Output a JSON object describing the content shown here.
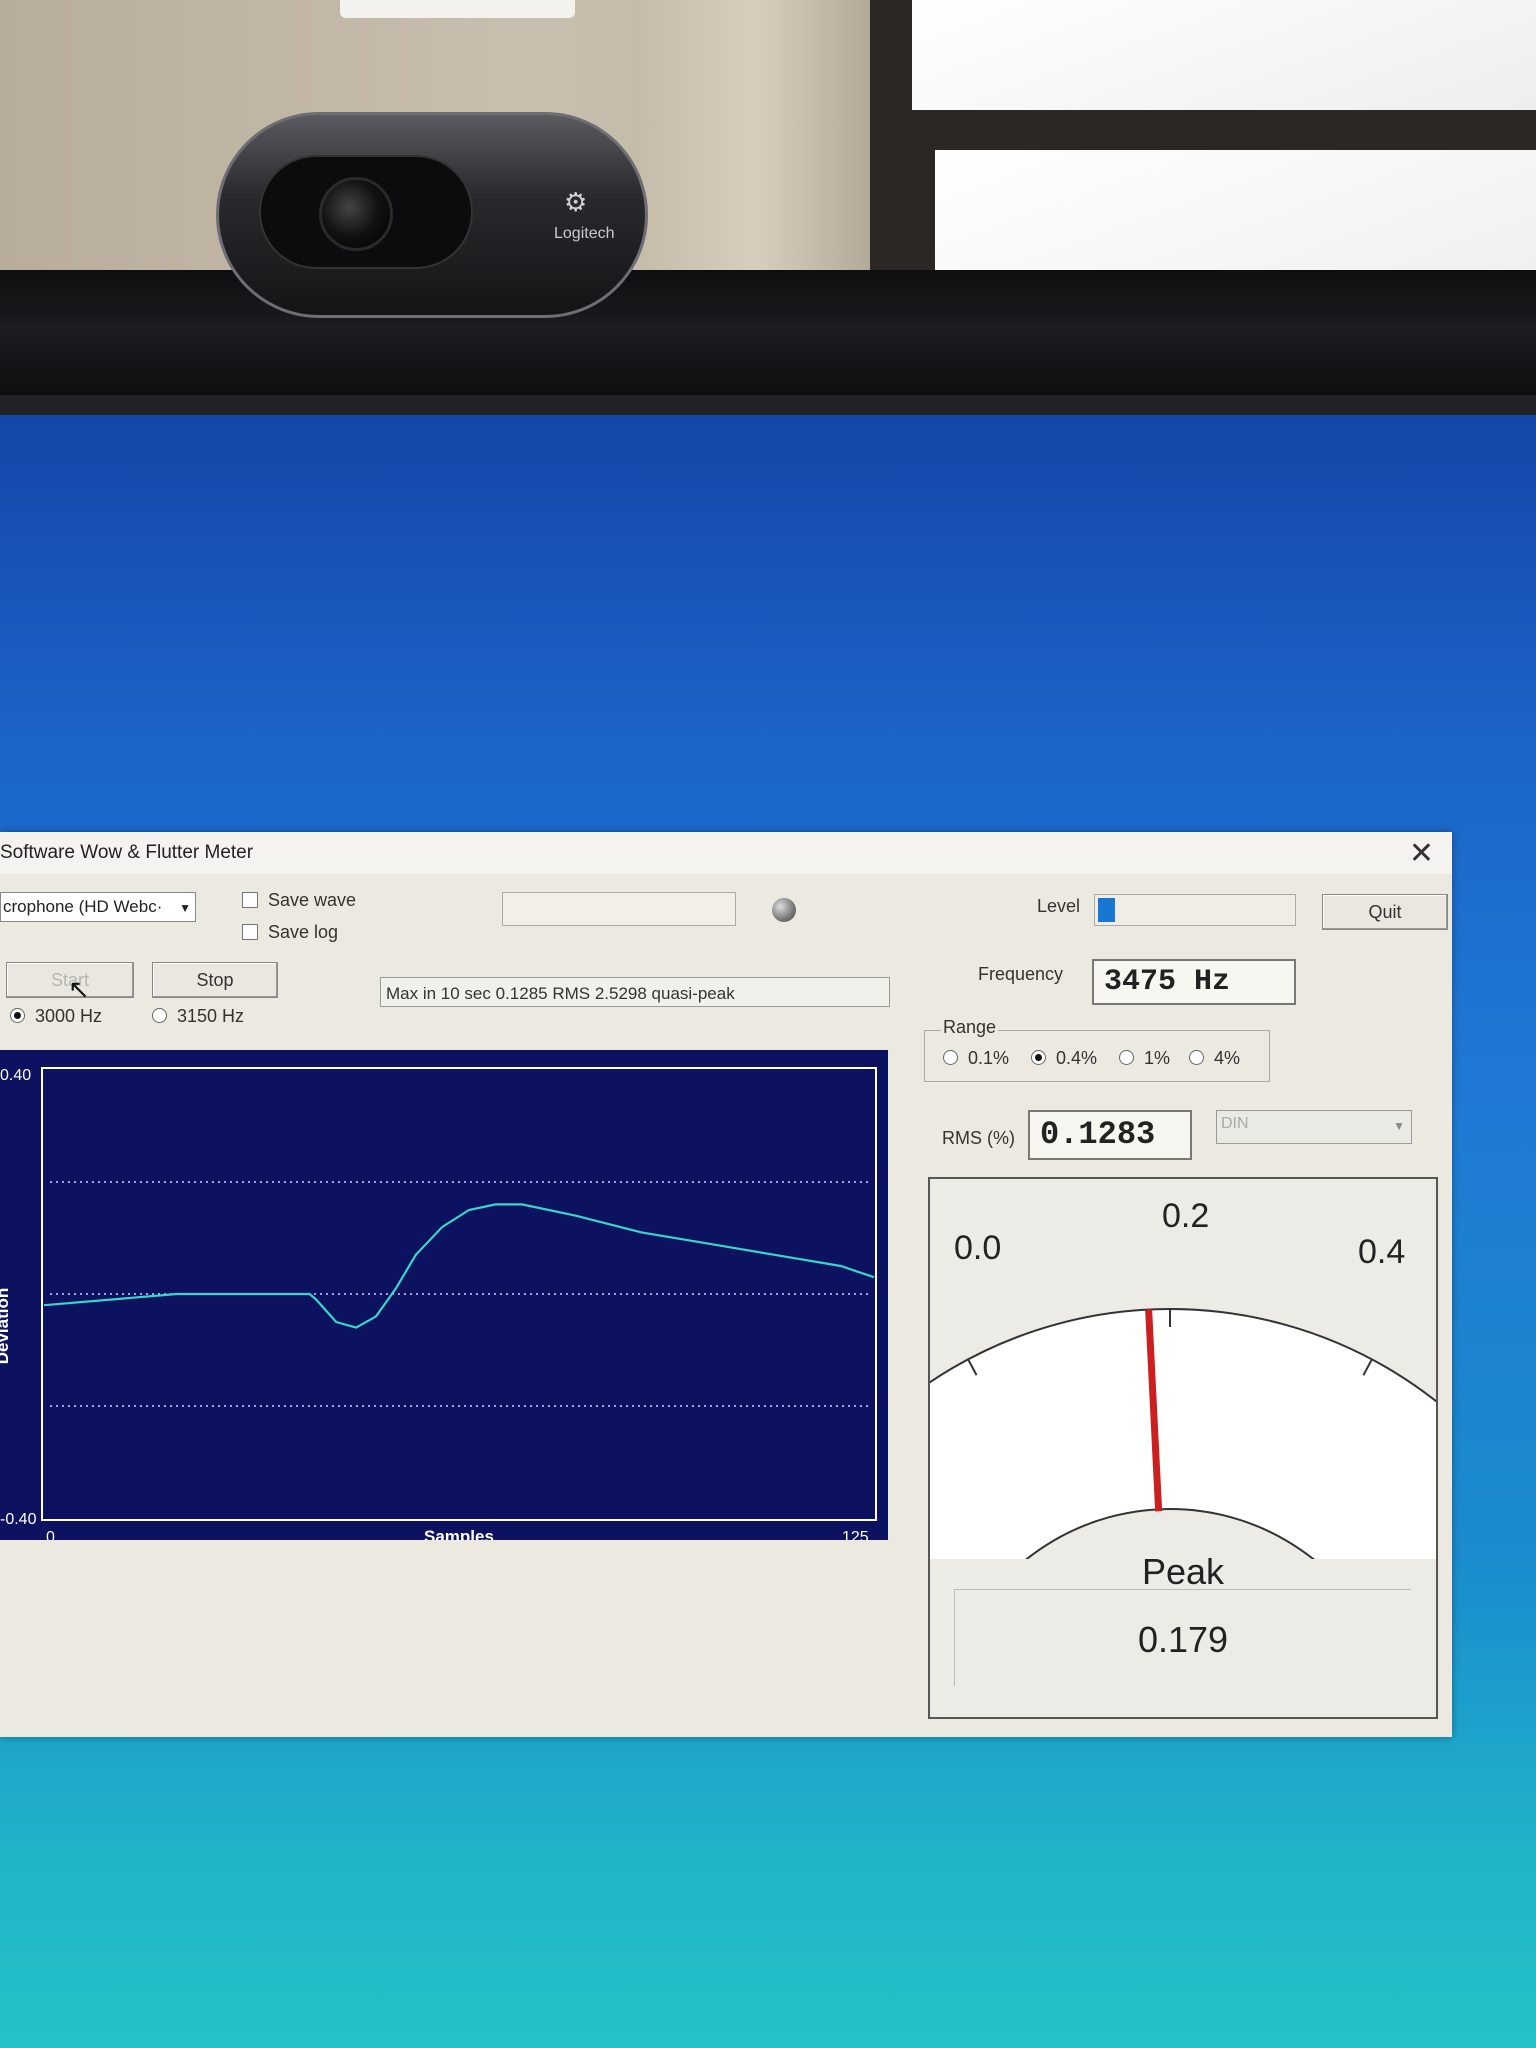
{
  "webcam": {
    "brand": "Logitech"
  },
  "app": {
    "title": "Software Wow & Flutter Meter",
    "close_icon": "close-icon",
    "device_select": {
      "value": "crophone (HD Webc·"
    },
    "save_wave_label": "Save wave",
    "save_log_label": "Save log",
    "level_label": "Level",
    "level_fraction": 0.09,
    "quit_label": "Quit",
    "start_label": "Start",
    "stop_label": "Stop",
    "freq_3000_label": "3000 Hz",
    "freq_3150_label": "3150 Hz",
    "status_text": "Max in 10 sec 0.1285 RMS 2.5298 quasi-peak",
    "frequency_label": "Frequency",
    "frequency_value": "3475  Hz",
    "range_label": "Range",
    "range_options": [
      "0.1%",
      "0.4%",
      "1%",
      "4%"
    ],
    "range_selected": "0.4%",
    "rms_label": "RMS (%)",
    "rms_value": "0.1283",
    "weighting_select": {
      "value": "DIN"
    },
    "meter": {
      "scale_min": "0.0",
      "scale_mid": "0.2",
      "scale_max": "0.4",
      "needle_value": 0.19,
      "peak_label": "Peak",
      "peak_value": "0.179"
    }
  },
  "chart_data": {
    "type": "line",
    "title": "",
    "xlabel": "Samples",
    "ylabel": "Deviation",
    "xlim": [
      0,
      125
    ],
    "ylim": [
      -0.4,
      0.4
    ],
    "ytick_labels": [
      "0.40",
      "-0.40"
    ],
    "xtick_labels": [
      "0",
      "125"
    ],
    "gridlines_y": [
      0.2,
      0.0,
      -0.2
    ],
    "series": [
      {
        "color": "#38d6c8",
        "x": [
          0,
          10,
          20,
          30,
          40,
          41,
          44,
          47,
          50,
          53,
          56,
          60,
          64,
          68,
          72,
          80,
          90,
          100,
          110,
          120,
          125
        ],
        "y": [
          -0.02,
          -0.01,
          0.0,
          0.0,
          0.0,
          -0.01,
          -0.05,
          -0.06,
          -0.04,
          0.01,
          0.07,
          0.12,
          0.15,
          0.16,
          0.16,
          0.14,
          0.11,
          0.09,
          0.07,
          0.05,
          0.03
        ]
      }
    ]
  }
}
